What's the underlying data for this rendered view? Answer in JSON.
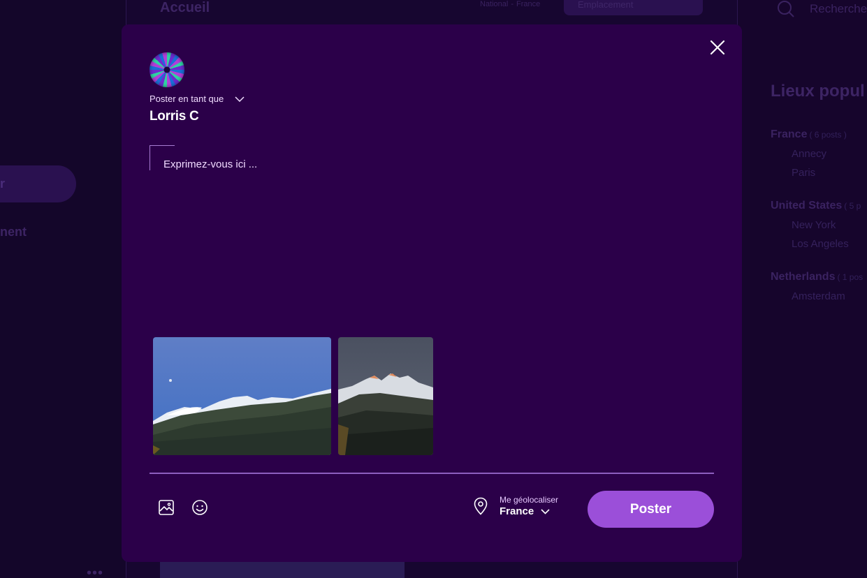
{
  "background": {
    "page_title": "Accueil",
    "breadcrumb": [
      "National",
      "France"
    ],
    "location_select_placeholder": "Emplacement",
    "nav_partial_1": "r",
    "nav_partial_2": "nent",
    "search_placeholder": "Recherche",
    "popular_title": "Lieux popul",
    "places": [
      {
        "country": "France",
        "count": "( 6 posts )",
        "cities": [
          "Annecy",
          "Paris"
        ]
      },
      {
        "country": "United States",
        "count": "( 5 p",
        "cities": [
          "New York",
          "Los Angeles"
        ]
      },
      {
        "country": "Netherlands",
        "count": "( 1 pos",
        "cities": [
          "Amsterdam"
        ]
      }
    ]
  },
  "modal": {
    "post_as_label": "Poster en tant que",
    "username": "Lorris C",
    "textarea_placeholder": "Exprimez-vous ici ...",
    "images": [
      {
        "icon": "mountain-photo-snowy-forest"
      },
      {
        "icon": "mountain-photo-dusk-peaks"
      }
    ],
    "geo_label": "Me géolocaliser",
    "geo_value": "France",
    "submit_label": "Poster"
  },
  "colors": {
    "modal_bg": "#2b0049",
    "accent": "#9b4fd9",
    "text_light": "#f1dcff"
  }
}
